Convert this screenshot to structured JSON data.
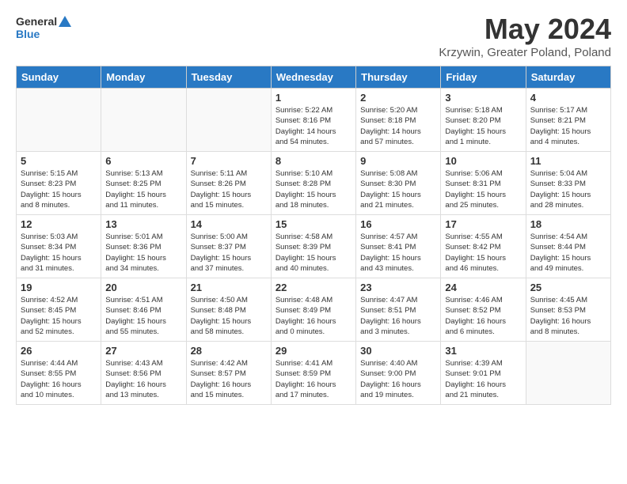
{
  "header": {
    "logo_line1": "General",
    "logo_line2": "Blue",
    "month_title": "May 2024",
    "location": "Krzywin, Greater Poland, Poland"
  },
  "weekdays": [
    "Sunday",
    "Monday",
    "Tuesday",
    "Wednesday",
    "Thursday",
    "Friday",
    "Saturday"
  ],
  "weeks": [
    [
      {
        "day": "",
        "info": ""
      },
      {
        "day": "",
        "info": ""
      },
      {
        "day": "",
        "info": ""
      },
      {
        "day": "1",
        "info": "Sunrise: 5:22 AM\nSunset: 8:16 PM\nDaylight: 14 hours\nand 54 minutes."
      },
      {
        "day": "2",
        "info": "Sunrise: 5:20 AM\nSunset: 8:18 PM\nDaylight: 14 hours\nand 57 minutes."
      },
      {
        "day": "3",
        "info": "Sunrise: 5:18 AM\nSunset: 8:20 PM\nDaylight: 15 hours\nand 1 minute."
      },
      {
        "day": "4",
        "info": "Sunrise: 5:17 AM\nSunset: 8:21 PM\nDaylight: 15 hours\nand 4 minutes."
      }
    ],
    [
      {
        "day": "5",
        "info": "Sunrise: 5:15 AM\nSunset: 8:23 PM\nDaylight: 15 hours\nand 8 minutes."
      },
      {
        "day": "6",
        "info": "Sunrise: 5:13 AM\nSunset: 8:25 PM\nDaylight: 15 hours\nand 11 minutes."
      },
      {
        "day": "7",
        "info": "Sunrise: 5:11 AM\nSunset: 8:26 PM\nDaylight: 15 hours\nand 15 minutes."
      },
      {
        "day": "8",
        "info": "Sunrise: 5:10 AM\nSunset: 8:28 PM\nDaylight: 15 hours\nand 18 minutes."
      },
      {
        "day": "9",
        "info": "Sunrise: 5:08 AM\nSunset: 8:30 PM\nDaylight: 15 hours\nand 21 minutes."
      },
      {
        "day": "10",
        "info": "Sunrise: 5:06 AM\nSunset: 8:31 PM\nDaylight: 15 hours\nand 25 minutes."
      },
      {
        "day": "11",
        "info": "Sunrise: 5:04 AM\nSunset: 8:33 PM\nDaylight: 15 hours\nand 28 minutes."
      }
    ],
    [
      {
        "day": "12",
        "info": "Sunrise: 5:03 AM\nSunset: 8:34 PM\nDaylight: 15 hours\nand 31 minutes."
      },
      {
        "day": "13",
        "info": "Sunrise: 5:01 AM\nSunset: 8:36 PM\nDaylight: 15 hours\nand 34 minutes."
      },
      {
        "day": "14",
        "info": "Sunrise: 5:00 AM\nSunset: 8:37 PM\nDaylight: 15 hours\nand 37 minutes."
      },
      {
        "day": "15",
        "info": "Sunrise: 4:58 AM\nSunset: 8:39 PM\nDaylight: 15 hours\nand 40 minutes."
      },
      {
        "day": "16",
        "info": "Sunrise: 4:57 AM\nSunset: 8:41 PM\nDaylight: 15 hours\nand 43 minutes."
      },
      {
        "day": "17",
        "info": "Sunrise: 4:55 AM\nSunset: 8:42 PM\nDaylight: 15 hours\nand 46 minutes."
      },
      {
        "day": "18",
        "info": "Sunrise: 4:54 AM\nSunset: 8:44 PM\nDaylight: 15 hours\nand 49 minutes."
      }
    ],
    [
      {
        "day": "19",
        "info": "Sunrise: 4:52 AM\nSunset: 8:45 PM\nDaylight: 15 hours\nand 52 minutes."
      },
      {
        "day": "20",
        "info": "Sunrise: 4:51 AM\nSunset: 8:46 PM\nDaylight: 15 hours\nand 55 minutes."
      },
      {
        "day": "21",
        "info": "Sunrise: 4:50 AM\nSunset: 8:48 PM\nDaylight: 15 hours\nand 58 minutes."
      },
      {
        "day": "22",
        "info": "Sunrise: 4:48 AM\nSunset: 8:49 PM\nDaylight: 16 hours\nand 0 minutes."
      },
      {
        "day": "23",
        "info": "Sunrise: 4:47 AM\nSunset: 8:51 PM\nDaylight: 16 hours\nand 3 minutes."
      },
      {
        "day": "24",
        "info": "Sunrise: 4:46 AM\nSunset: 8:52 PM\nDaylight: 16 hours\nand 6 minutes."
      },
      {
        "day": "25",
        "info": "Sunrise: 4:45 AM\nSunset: 8:53 PM\nDaylight: 16 hours\nand 8 minutes."
      }
    ],
    [
      {
        "day": "26",
        "info": "Sunrise: 4:44 AM\nSunset: 8:55 PM\nDaylight: 16 hours\nand 10 minutes."
      },
      {
        "day": "27",
        "info": "Sunrise: 4:43 AM\nSunset: 8:56 PM\nDaylight: 16 hours\nand 13 minutes."
      },
      {
        "day": "28",
        "info": "Sunrise: 4:42 AM\nSunset: 8:57 PM\nDaylight: 16 hours\nand 15 minutes."
      },
      {
        "day": "29",
        "info": "Sunrise: 4:41 AM\nSunset: 8:59 PM\nDaylight: 16 hours\nand 17 minutes."
      },
      {
        "day": "30",
        "info": "Sunrise: 4:40 AM\nSunset: 9:00 PM\nDaylight: 16 hours\nand 19 minutes."
      },
      {
        "day": "31",
        "info": "Sunrise: 4:39 AM\nSunset: 9:01 PM\nDaylight: 16 hours\nand 21 minutes."
      },
      {
        "day": "",
        "info": ""
      }
    ]
  ]
}
